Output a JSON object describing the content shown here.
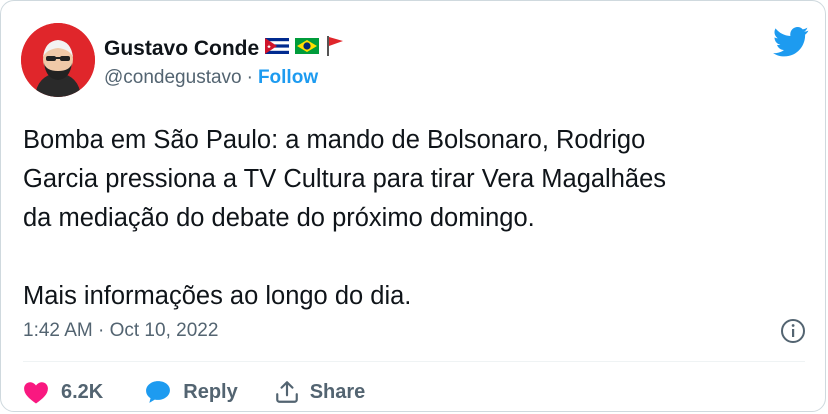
{
  "author": {
    "name": "Gustavo Conde",
    "handle": "@condegustavo",
    "separator": "·",
    "follow_label": "Follow",
    "flags": [
      "cuba-flag-icon",
      "brazil-flag-icon",
      "red-flag-icon"
    ]
  },
  "tweet": {
    "text": "Bomba em São Paulo: a mando de Bolsonaro, Rodrigo\nGarcia pressiona a TV Cultura para tirar Vera Magalhães\nda mediação do debate do próximo domingo.\n\nMais informações ao longo do dia.",
    "timestamp": "1:42 AM · Oct 10, 2022"
  },
  "actions": {
    "like_count": "6.2K",
    "reply_label": "Reply",
    "share_label": "Share"
  },
  "colors": {
    "accent": "#1d9bf0",
    "like": "#f91880",
    "text": "#0f1419",
    "muted": "#536471",
    "avatar_bg": "#e0262b"
  }
}
